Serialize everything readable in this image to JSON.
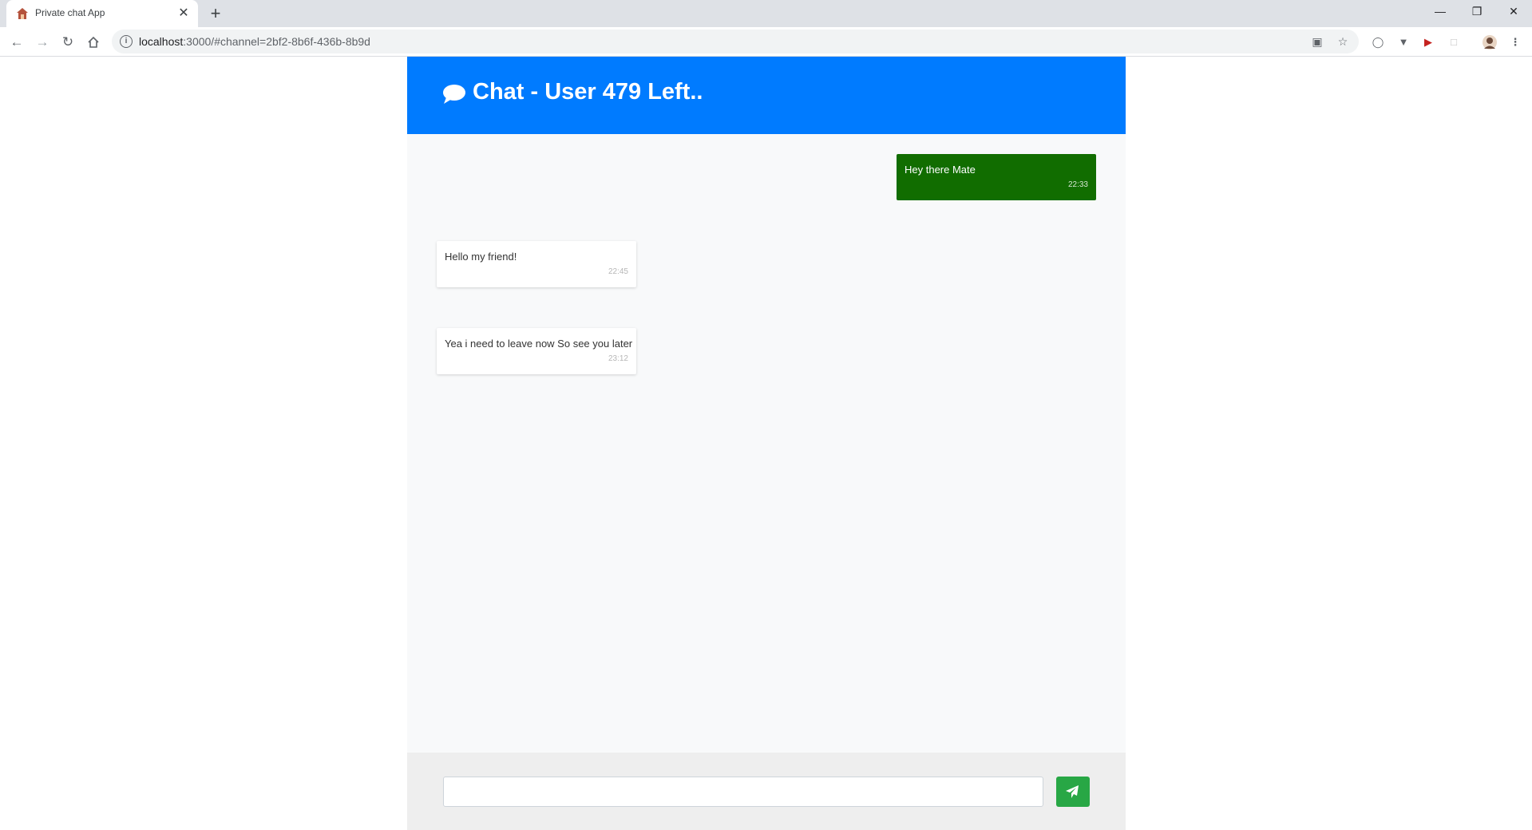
{
  "browser": {
    "tab_title": "Private chat App",
    "tab_close": "✕",
    "new_tab": "+",
    "url_host": "localhost",
    "url_rest": ":3000/#channel=2bf2-8b6f-436b-8b9d",
    "window_controls": {
      "minimize": "—",
      "restore": "❐",
      "close": "✕"
    }
  },
  "header": {
    "title": "Chat - User 479 Left..",
    "icon": "comment-icon",
    "color": "#007bff"
  },
  "messages": [
    {
      "type": "sent",
      "text": "Hey there Mate",
      "time": "22:33"
    },
    {
      "type": "received",
      "text": "Hello my friend!",
      "time": "22:45"
    },
    {
      "type": "received",
      "text": "Yea i need to leave now So see you later",
      "time": "23:12"
    }
  ],
  "composer": {
    "input_value": "",
    "placeholder": "",
    "send_icon": "paper-plane-icon",
    "send_color": "#28a745"
  },
  "colors": {
    "sent_bubble": "#116d00",
    "received_bubble": "#ffffff",
    "chat_background": "#f8f9fa"
  }
}
